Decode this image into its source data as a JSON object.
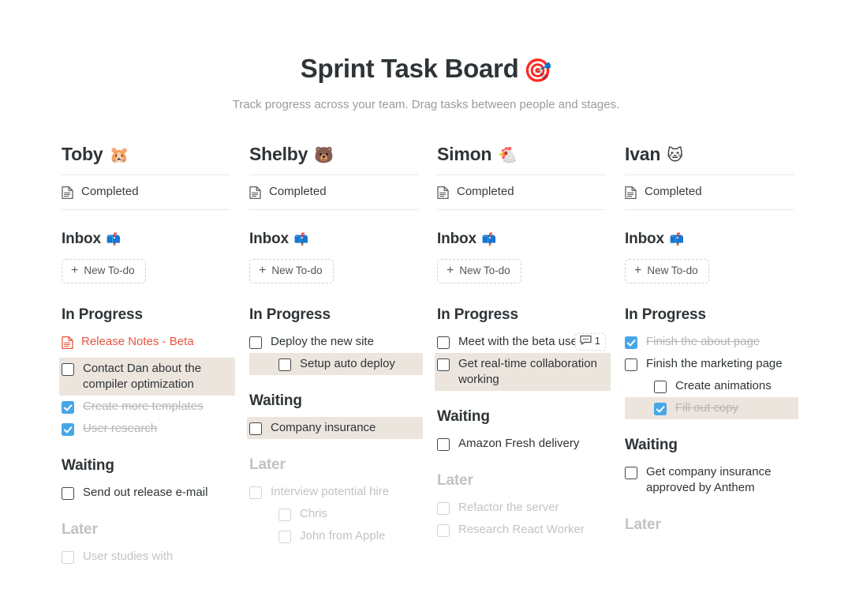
{
  "header": {
    "title": "Sprint Task Board",
    "title_emoji": "🎯",
    "subtitle": "Track progress across your team.  Drag tasks between people and stages."
  },
  "labels": {
    "completed": "Completed",
    "new_todo": "New To-do",
    "plus": "+",
    "inbox_emoji": "📫",
    "section_inbox": "Inbox",
    "section_in_progress": "In Progress",
    "section_waiting": "Waiting",
    "section_later": "Later"
  },
  "colors": {
    "accent_blue": "#47a6e8",
    "highlight": "#ece5de",
    "link_red": "#e8553e",
    "text": "#2f3437",
    "muted": "#c3c3c1",
    "divider": "#e8e8e7"
  },
  "columns": [
    {
      "name": "Toby",
      "emoji": "🐹",
      "in_progress": [
        {
          "text": "Release Notes - Beta",
          "kind": "doc-link",
          "checked": false,
          "indent": 0,
          "highlight": false,
          "muted": false
        },
        {
          "text": "Contact Dan about the compiler optimization",
          "kind": "checkbox",
          "checked": false,
          "indent": 0,
          "highlight": true,
          "muted": false
        },
        {
          "text": "Create more templates",
          "kind": "checkbox",
          "checked": true,
          "indent": 0,
          "highlight": false,
          "muted": false
        },
        {
          "text": "User research",
          "kind": "checkbox",
          "checked": true,
          "indent": 0,
          "highlight": false,
          "muted": false
        }
      ],
      "waiting": [
        {
          "text": "Send out release e-mail",
          "kind": "checkbox",
          "checked": false,
          "indent": 0,
          "highlight": false,
          "muted": false
        }
      ],
      "later": [
        {
          "text": "User studies with",
          "kind": "checkbox",
          "checked": false,
          "indent": 0,
          "highlight": false,
          "muted": true
        }
      ]
    },
    {
      "name": "Shelby",
      "emoji": "🐻",
      "in_progress": [
        {
          "text": "Deploy the new site",
          "kind": "checkbox",
          "checked": false,
          "indent": 0,
          "highlight": false,
          "muted": false
        },
        {
          "text": "Setup auto deploy",
          "kind": "checkbox",
          "checked": false,
          "indent": 1,
          "highlight": true,
          "muted": false
        }
      ],
      "waiting": [
        {
          "text": "Company insurance",
          "kind": "checkbox",
          "checked": false,
          "indent": 0,
          "highlight": true,
          "muted": false
        }
      ],
      "later": [
        {
          "text": "Interview potential hire",
          "kind": "checkbox",
          "checked": false,
          "indent": 0,
          "highlight": false,
          "muted": true
        },
        {
          "text": "Chris",
          "kind": "checkbox",
          "checked": false,
          "indent": 1,
          "highlight": false,
          "muted": true
        },
        {
          "text": "John from Apple",
          "kind": "checkbox",
          "checked": false,
          "indent": 1,
          "highlight": false,
          "muted": true
        }
      ]
    },
    {
      "name": "Simon",
      "emoji": "🐔",
      "in_progress": [
        {
          "text": "Meet with the beta users",
          "kind": "checkbox",
          "checked": false,
          "indent": 0,
          "highlight": false,
          "muted": false,
          "comment_count": "1"
        },
        {
          "text": "Get real-time collaboration working",
          "kind": "checkbox",
          "checked": false,
          "indent": 0,
          "highlight": true,
          "muted": false
        }
      ],
      "waiting": [
        {
          "text": "Amazon Fresh delivery",
          "kind": "checkbox",
          "checked": false,
          "indent": 0,
          "highlight": false,
          "muted": false
        }
      ],
      "later": [
        {
          "text": "Refactor the server",
          "kind": "checkbox",
          "checked": false,
          "indent": 0,
          "highlight": false,
          "muted": true
        },
        {
          "text": "Research React Worker",
          "kind": "checkbox",
          "checked": false,
          "indent": 0,
          "highlight": false,
          "muted": true
        }
      ]
    },
    {
      "name": "Ivan",
      "emoji": "🐱",
      "in_progress": [
        {
          "text": "Finish the about page",
          "kind": "checkbox",
          "checked": true,
          "indent": 0,
          "highlight": false,
          "muted": false
        },
        {
          "text": "Finish the marketing page",
          "kind": "checkbox",
          "checked": false,
          "indent": 0,
          "highlight": false,
          "muted": false
        },
        {
          "text": "Create animations",
          "kind": "checkbox",
          "checked": false,
          "indent": 1,
          "highlight": false,
          "muted": false
        },
        {
          "text": "Fill out copy",
          "kind": "checkbox",
          "checked": true,
          "indent": 1,
          "highlight": true,
          "muted": false
        }
      ],
      "waiting": [
        {
          "text": "Get company insurance approved by Anthem",
          "kind": "checkbox",
          "checked": false,
          "indent": 0,
          "highlight": false,
          "muted": false
        }
      ],
      "later": []
    }
  ]
}
